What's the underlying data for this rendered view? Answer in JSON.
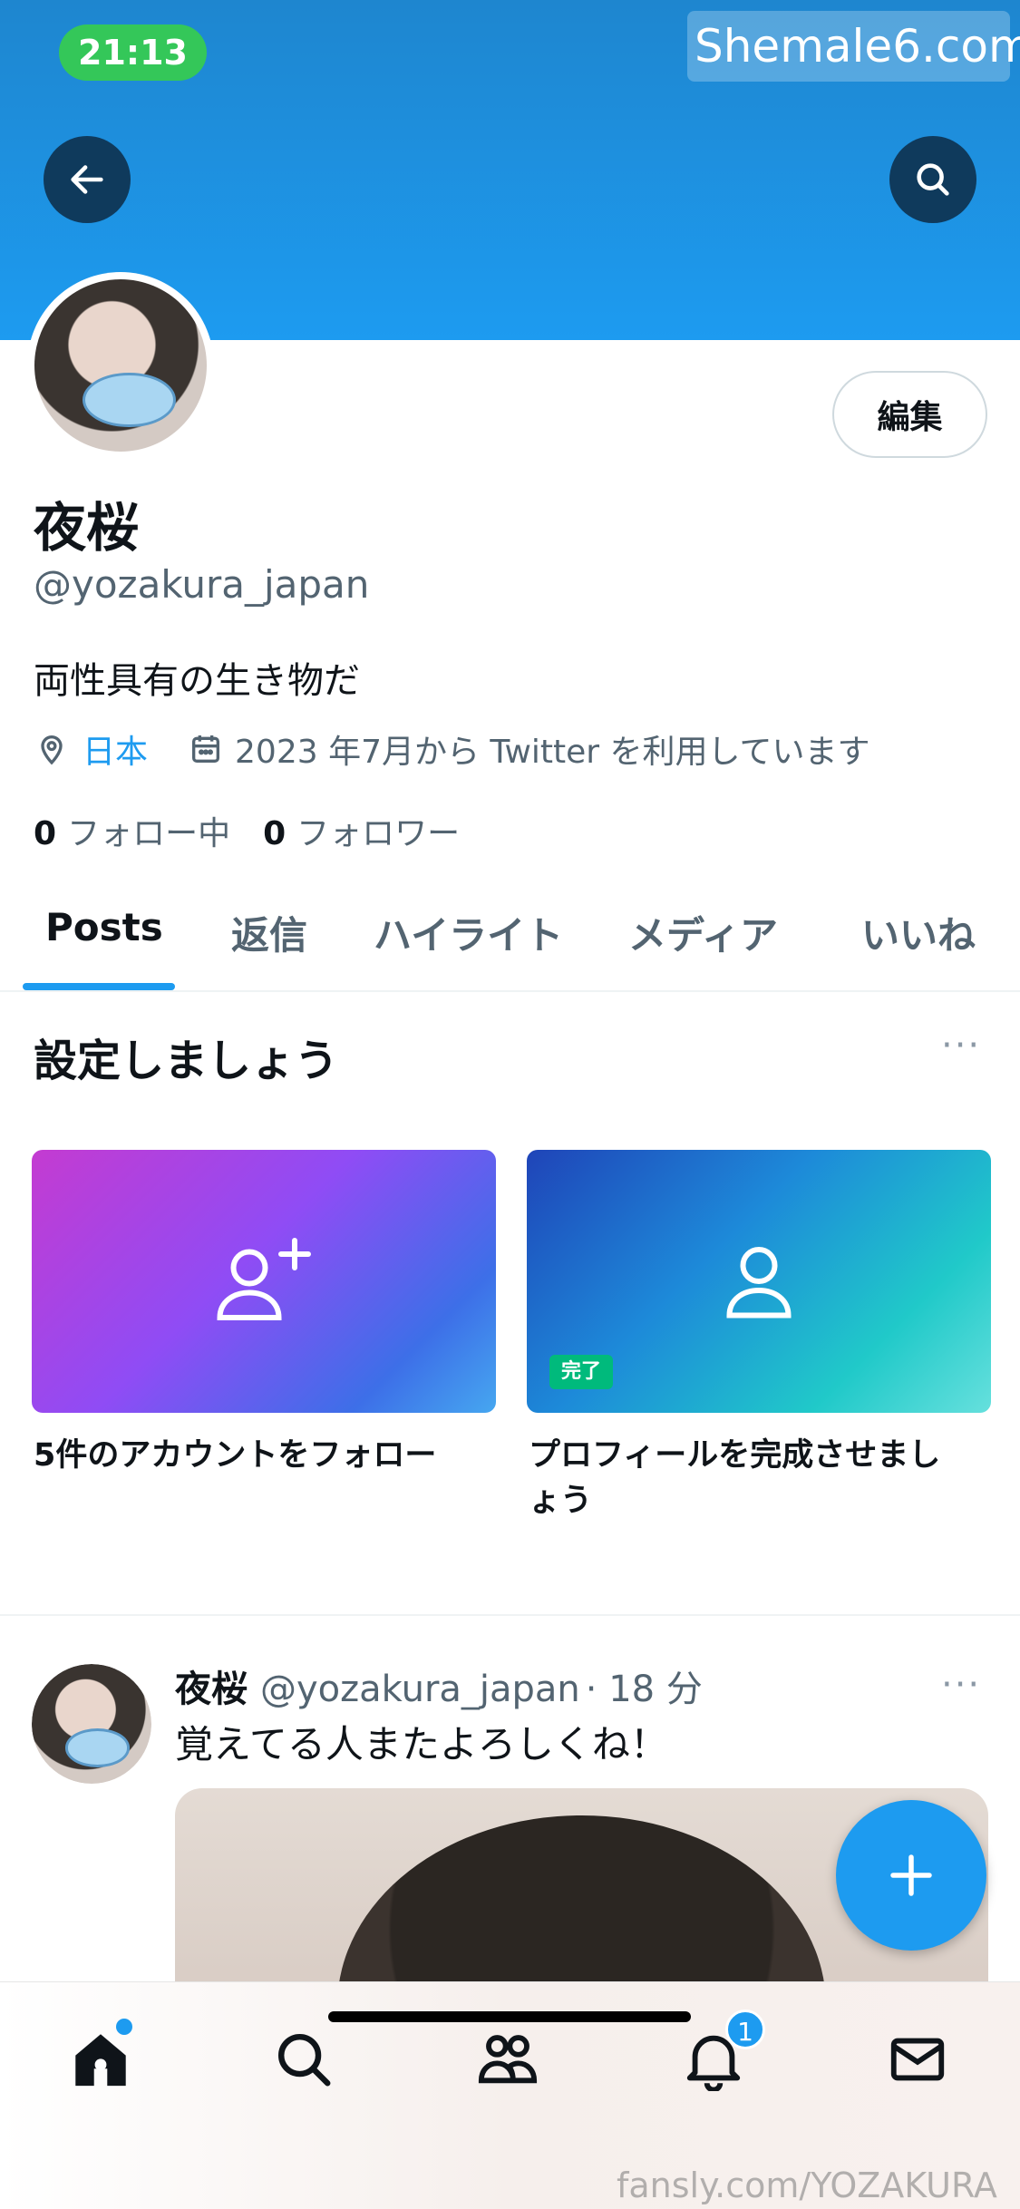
{
  "status_bar": {
    "time": "21:13"
  },
  "watermark_top": "Shemale6.com",
  "watermark_bottom": "fansly.com/YOZAKURA",
  "profile": {
    "edit_label": "編集",
    "display_name": "夜桜",
    "handle": "@yozakura_japan",
    "bio": "両性具有の生き物だ",
    "location": "日本",
    "joined": "2023 年7月から Twitter を利用しています",
    "following_count": "0",
    "following_label": "フォロー中",
    "followers_count": "0",
    "followers_label": "フォロワー"
  },
  "tabs": [
    {
      "label": "Posts",
      "active": true
    },
    {
      "label": "返信"
    },
    {
      "label": "ハイライト"
    },
    {
      "label": "メディア"
    },
    {
      "label": "いいね"
    }
  ],
  "setup": {
    "title": "設定しましょう",
    "more": "···",
    "cards": [
      {
        "label": "5件のアカウントをフォロー",
        "icon": "person-add-icon"
      },
      {
        "label": "プロフィールを完成させまし\nょう",
        "icon": "person-icon",
        "badge": "完了"
      }
    ]
  },
  "post": {
    "name": "夜桜",
    "handle": "@yozakura_japan",
    "time": "· 18 分",
    "text": "覚えてる人またよろしくね！",
    "more": "···"
  },
  "bottom_nav": {
    "items": [
      "home-icon",
      "search-icon",
      "communities-icon",
      "bell-icon",
      "mail-icon"
    ],
    "notification_badge": "1"
  },
  "colors": {
    "accent": "#1d9bf0",
    "banner": "#1e86cf",
    "time_pill": "#34c759",
    "done": "#00ba7c"
  }
}
